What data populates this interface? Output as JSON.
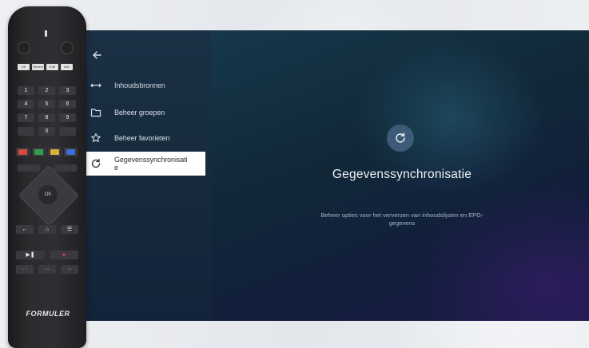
{
  "sidebar": {
    "back_icon": "arrow-left-icon",
    "items": [
      {
        "label": "Inhoudsbronnen",
        "icon": "swap-arrows-icon",
        "active": false
      },
      {
        "label": "Beheer groepen",
        "icon": "folder-icon",
        "active": false
      },
      {
        "label": "Beheer favorieten",
        "icon": "star-icon",
        "active": false
      },
      {
        "label": "Gegevenssynchronisatie",
        "icon": "refresh-icon",
        "active": true
      }
    ]
  },
  "detail": {
    "icon": "refresh-icon",
    "title": "Gegevenssynchronisatie",
    "subtitle": "Beheer opties voor het verversen van inhoudslijsten en EPG-gegevens"
  },
  "remote": {
    "brand": "FORMULER",
    "top_small_buttons": [
      "OK",
      "Recent",
      "Edit",
      "Info"
    ],
    "number_keys": [
      "1",
      "2",
      "3",
      "4",
      "5",
      "6",
      "7",
      "8",
      "9",
      "",
      "0",
      ""
    ],
    "color_keys": [
      "#d64a3a",
      "#2fa04a",
      "#d9b03a",
      "#3a6fd6"
    ],
    "ok_label": "OK"
  },
  "colors": {
    "screen_background": "#101b2c",
    "sidebar_background": "#172c3f",
    "active_item_background": "#ffffff",
    "accent_badge": "#3d5a78"
  }
}
